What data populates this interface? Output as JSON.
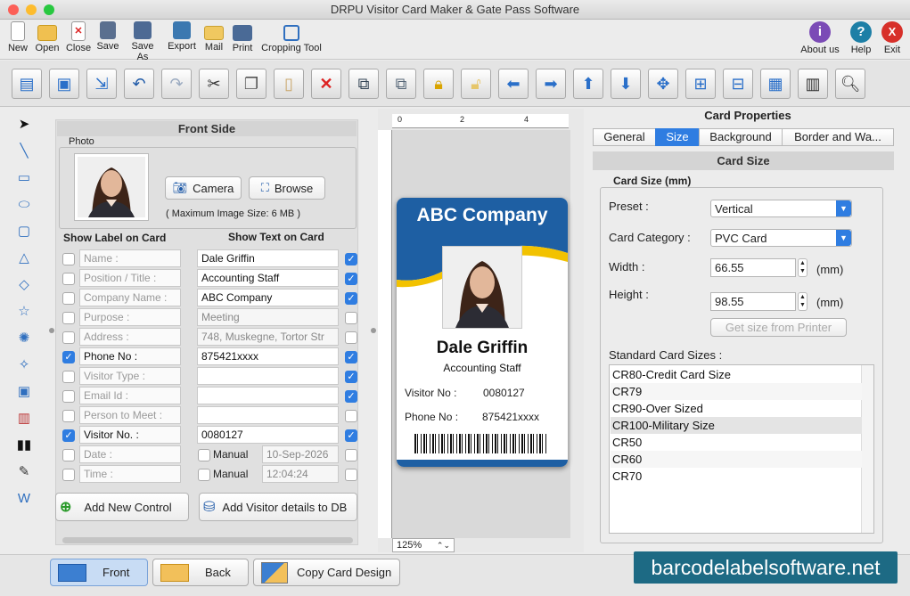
{
  "window": {
    "title": "DRPU Visitor Card Maker & Gate Pass Software"
  },
  "toolbar": {
    "left": [
      {
        "label": "New",
        "icon": "new-file-icon"
      },
      {
        "label": "Open",
        "icon": "open-folder-icon"
      },
      {
        "label": "Close",
        "icon": "close-file-icon"
      },
      {
        "label": "Save",
        "icon": "save-icon"
      },
      {
        "label": "Save As",
        "icon": "save-as-icon"
      },
      {
        "label": "Export",
        "icon": "export-icon"
      },
      {
        "label": "Mail",
        "icon": "mail-icon"
      },
      {
        "label": "Print",
        "icon": "print-icon"
      },
      {
        "label": "Cropping Tool",
        "icon": "crop-icon"
      }
    ],
    "right": [
      {
        "label": "About us",
        "icon": "info-icon",
        "glyph": "i",
        "color": "#7b4bb6"
      },
      {
        "label": "Help",
        "icon": "help-icon",
        "glyph": "?",
        "color": "#1d7fa6"
      },
      {
        "label": "Exit",
        "icon": "exit-icon",
        "glyph": "X",
        "color": "#d7302a"
      }
    ]
  },
  "front_panel": {
    "title": "Front Side",
    "photo_group": "Photo",
    "camera_label": "Camera",
    "browse_label": "Browse",
    "max_size": "( Maximum Image Size: 6 MB )",
    "show_label_header": "Show Label on Card",
    "show_text_header": "Show Text on Card",
    "rows": [
      {
        "label": "Name :",
        "label_on": false,
        "text": "Dale Griffin",
        "text_on": true,
        "dim": false
      },
      {
        "label": "Position / Title :",
        "label_on": false,
        "text": "Accounting Staff",
        "text_on": true,
        "dim": false
      },
      {
        "label": "Company Name :",
        "label_on": false,
        "text": "ABC Company",
        "text_on": true,
        "dim": false
      },
      {
        "label": "Purpose :",
        "label_on": false,
        "text": "Meeting",
        "text_on": false,
        "dim": true
      },
      {
        "label": "Address :",
        "label_on": false,
        "text": "748, Muskegne, Tortor Str",
        "text_on": false,
        "dim": true
      },
      {
        "label": "Phone No :",
        "label_on": true,
        "text": "875421xxxx",
        "text_on": true,
        "dim": false
      },
      {
        "label": "Visitor Type :",
        "label_on": false,
        "text": "",
        "text_on": true,
        "dim": false
      },
      {
        "label": "Email Id :",
        "label_on": false,
        "text": "",
        "text_on": true,
        "dim": false
      },
      {
        "label": "Person to Meet :",
        "label_on": false,
        "text": "",
        "text_on": false,
        "dim": false
      },
      {
        "label": "Visitor No. :",
        "label_on": true,
        "text": "0080127",
        "text_on": true,
        "dim": false
      }
    ],
    "date_label": "Date :",
    "time_label": "Time :",
    "manual_label": "Manual",
    "date_value": "10-Sep-2026",
    "time_value": "12:04:24",
    "add_control_label": "Add New Control",
    "add_visitor_label": "Add Visitor details to DB"
  },
  "card": {
    "company": "ABC Company",
    "name": "Dale Griffin",
    "position": "Accounting Staff",
    "visitor_label": "Visitor No :",
    "visitor_value": "0080127",
    "phone_label": "Phone No :",
    "phone_value": "875421xxxx",
    "header_color": "#1e5fa3",
    "accent_color": "#f2c200"
  },
  "ruler": {
    "ticks": [
      "0",
      "2",
      "4"
    ]
  },
  "zoom": "125%",
  "properties": {
    "title": "Card Properties",
    "tabs": [
      "General",
      "Size",
      "Background",
      "Border and Wa..."
    ],
    "selected_tab": "Size",
    "section": "Card Size",
    "group_title": "Card Size (mm)",
    "preset_label": "Preset :",
    "preset_value": "Vertical",
    "category_label": "Card Category :",
    "category_value": "PVC Card",
    "width_label": "Width :",
    "width_value": "66.55",
    "height_label": "Height :",
    "height_value": "98.55",
    "unit": "(mm)",
    "get_size_label": "Get size from Printer",
    "std_sizes_label": "Standard Card Sizes :",
    "std_sizes": [
      "CR80-Credit Card Size",
      "CR79",
      "CR90-Over Sized",
      "CR100-Military Size",
      "CR50",
      "CR60",
      "CR70"
    ],
    "selected_size": "CR100-Military Size"
  },
  "bottom": {
    "front_label": "Front",
    "back_label": "Back",
    "copy_label": "Copy Card Design",
    "watermark": "barcodelabelsoftware.net"
  }
}
